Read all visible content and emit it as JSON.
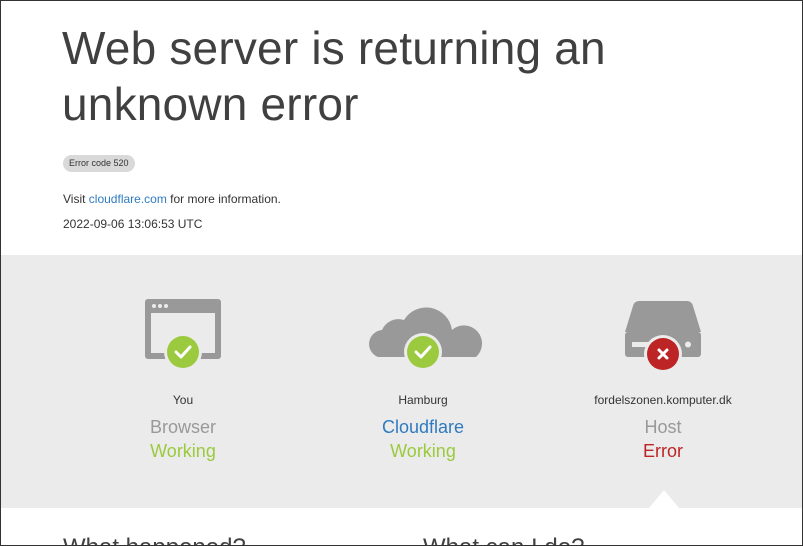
{
  "header": {
    "title": "Web server is returning an unknown error",
    "error_code": "Error code 520",
    "visit_prefix": "Visit ",
    "visit_link": "cloudflare.com",
    "visit_suffix": " for more information.",
    "timestamp": "2022-09-06 13:06:53 UTC"
  },
  "status": [
    {
      "location": "You",
      "name": "Browser",
      "state": "Working",
      "icon": "browser-window-icon",
      "badge": "check-icon"
    },
    {
      "location": "Hamburg",
      "name": "Cloudflare",
      "state": "Working",
      "icon": "cloud-icon",
      "badge": "check-icon"
    },
    {
      "location": "fordelszonen.komputer.dk",
      "name": "Host",
      "state": "Error",
      "icon": "server-drive-icon",
      "badge": "x-icon"
    }
  ],
  "sections": {
    "what_happened": "What happened?",
    "what_can_i_do": "What can I do?"
  },
  "colors": {
    "ok": "#9bca3e",
    "error": "#bd2426",
    "link": "#2f7bbf",
    "icon_gray": "#999999"
  }
}
